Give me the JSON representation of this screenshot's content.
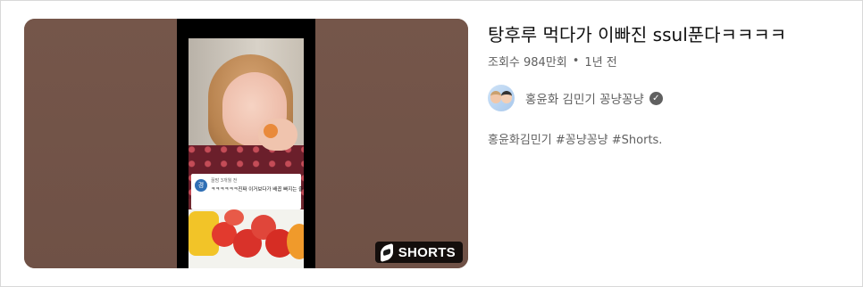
{
  "video": {
    "title": "탕후루 먹다가 이빠진 ssul푼다ㅋㅋㅋㅋ",
    "views": "조회수 984만회",
    "separator": "•",
    "age": "1년 전",
    "badge_label": "SHORTS",
    "channel_name": "홍윤화 김민기 꽁냥꽁냥",
    "verified_icon": "check-circle-icon",
    "description": "홍윤화김민기 #꽁냥꽁냥 #Shorts."
  },
  "thumbnail_overlay": {
    "comment_avatar_letter": "경",
    "comment_user": "꿀맘 3개월 전",
    "comment_text": "ㅋㅋㅋㅋㅋㅋ진짜 이거보다가 배꼽 빠지는 줄"
  },
  "colors": {
    "title": "#0f0f0f",
    "secondary_text": "#606060",
    "thumbnail_bg": "#75564a",
    "badge_bg": "#000000"
  }
}
